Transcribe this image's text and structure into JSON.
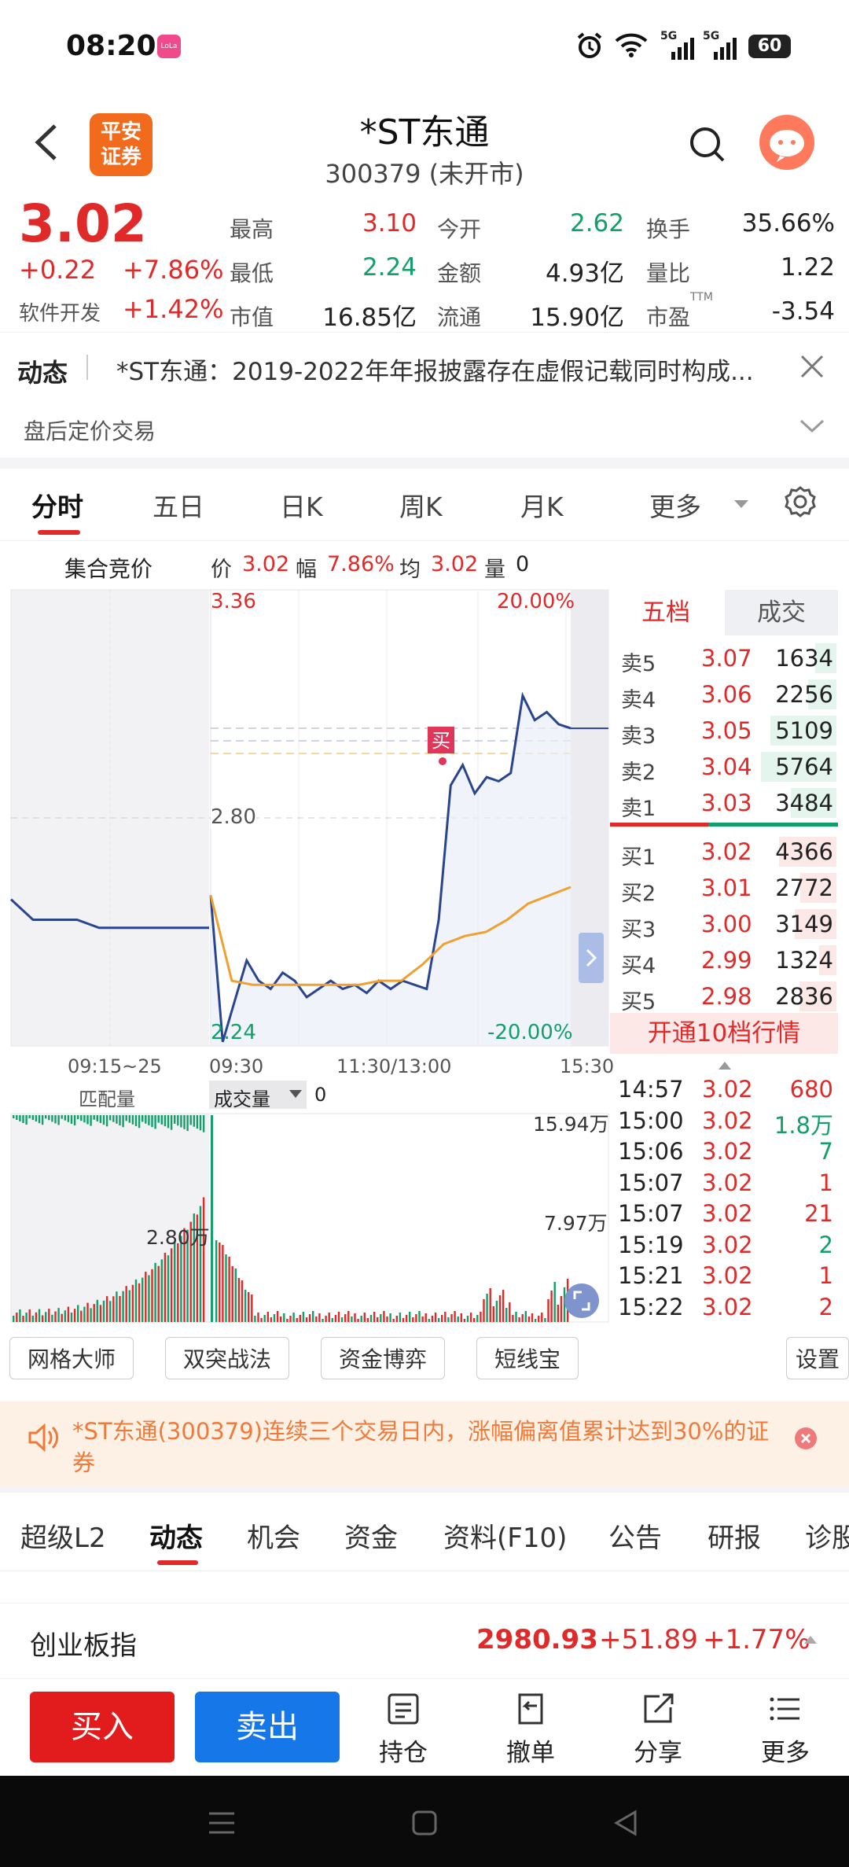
{
  "status_bar": {
    "time": "08:20",
    "app_badge": "LoLa",
    "net1": "5G",
    "net2": "5G",
    "battery": "60"
  },
  "header": {
    "title": "*ST东通",
    "subtitle": "300379 (未开市)",
    "logo_line1": "平安",
    "logo_line2": "证券"
  },
  "quote": {
    "price": "3.02",
    "change": "+0.22",
    "change_pct": "+7.86%",
    "sector": "软件开发",
    "sector_pct": "+1.42%",
    "stats": [
      {
        "label": "最高",
        "value": "3.10",
        "color": "red"
      },
      {
        "label": "今开",
        "value": "2.62",
        "color": "green"
      },
      {
        "label": "换手",
        "value": "35.66%",
        "color": "black"
      },
      {
        "label": "最低",
        "value": "2.24",
        "color": "green"
      },
      {
        "label": "金额",
        "value": "4.93亿",
        "color": "black"
      },
      {
        "label": "量比",
        "value": "1.22",
        "color": "black"
      },
      {
        "label": "市值",
        "value": "16.85亿",
        "color": "black"
      },
      {
        "label": "流通",
        "value": "15.90亿",
        "color": "black"
      },
      {
        "label": "市盈",
        "label_sup": "TTM",
        "value": "-3.54",
        "color": "black"
      }
    ]
  },
  "news": {
    "tag": "动态",
    "text": "*ST东通：2019-2022年年报披露存在虚假记载同时构成...",
    "after_hours": "盘后定价交易"
  },
  "chart_tabs": [
    "分时",
    "五日",
    "日K",
    "周K",
    "月K",
    "更多"
  ],
  "info_line": {
    "title": "集合竞价",
    "price_label": "价",
    "price": "3.02",
    "amp_label": "幅",
    "amp": "7.86%",
    "avg_label": "均",
    "avg": "3.02",
    "vol_label": "量",
    "vol": "0"
  },
  "chart_data": {
    "type": "line",
    "y_top_label": "3.36",
    "y_mid_label": "2.80",
    "y_bottom_label": "2.24",
    "pct_top": "20.00%",
    "pct_bottom": "-20.00%",
    "x_labels": [
      "09:15~25",
      "09:30",
      "11:30/13:00",
      "15:30"
    ],
    "ylim": [
      2.24,
      3.36
    ],
    "series": [
      {
        "values": [
          2.6,
          2.55,
          2.55,
          2.55,
          2.53,
          2.53,
          2.53,
          2.53,
          2.53,
          2.53,
          2.61,
          2.25,
          2.35,
          2.45,
          2.4,
          2.38,
          2.42,
          2.4,
          2.36,
          2.38,
          2.4,
          2.38,
          2.39,
          2.37,
          2.4,
          2.38,
          2.4,
          2.39,
          2.38,
          2.55,
          2.88,
          2.93,
          2.86,
          2.9,
          2.89,
          2.91,
          3.1,
          3.04,
          3.06,
          3.03,
          3.02
        ]
      },
      {
        "values": [
          2.61,
          2.4,
          2.39,
          2.39,
          2.39,
          2.39,
          2.39,
          2.39,
          2.4,
          2.4,
          2.44,
          2.49,
          2.51,
          2.52,
          2.55,
          2.59,
          2.61,
          2.63
        ]
      }
    ],
    "volume_labels": {
      "left_top": "匹配量",
      "selector": "成交量",
      "value": "0",
      "max": "15.94万",
      "mid": "7.97万",
      "auction": "2.80万"
    }
  },
  "order_book": {
    "tabs": [
      "五档",
      "成交"
    ],
    "asks": [
      {
        "name": "卖5",
        "price": "3.07",
        "vol": "1634",
        "frac": 0.28
      },
      {
        "name": "卖4",
        "price": "3.06",
        "vol": "2256",
        "frac": 0.38
      },
      {
        "name": "卖3",
        "price": "3.05",
        "vol": "5109",
        "frac": 0.88
      },
      {
        "name": "卖2",
        "price": "3.04",
        "vol": "5764",
        "frac": 1.0
      },
      {
        "name": "卖1",
        "price": "3.03",
        "vol": "3484",
        "frac": 0.6
      }
    ],
    "bids": [
      {
        "name": "买1",
        "price": "3.02",
        "vol": "4366",
        "frac": 0.76
      },
      {
        "name": "买2",
        "price": "3.01",
        "vol": "2772",
        "frac": 0.48
      },
      {
        "name": "买3",
        "price": "3.00",
        "vol": "3149",
        "frac": 0.55
      },
      {
        "name": "买4",
        "price": "2.99",
        "vol": "1324",
        "frac": 0.23
      },
      {
        "name": "买5",
        "price": "2.98",
        "vol": "2836",
        "frac": 0.49
      }
    ],
    "promo": "开通10档行情",
    "ticks": [
      {
        "time": "14:57",
        "price": "3.02",
        "vol": "680",
        "color": "red"
      },
      {
        "time": "15:00",
        "price": "3.02",
        "vol": "1.8万",
        "color": "green"
      },
      {
        "time": "15:06",
        "price": "3.02",
        "vol": "7",
        "color": "green"
      },
      {
        "time": "15:07",
        "price": "3.02",
        "vol": "1",
        "color": "red"
      },
      {
        "time": "15:07",
        "price": "3.02",
        "vol": "21",
        "color": "red"
      },
      {
        "time": "15:19",
        "price": "3.02",
        "vol": "2",
        "color": "green"
      },
      {
        "time": "15:21",
        "price": "3.02",
        "vol": "1",
        "color": "red"
      },
      {
        "time": "15:22",
        "price": "3.02",
        "vol": "2",
        "color": "red"
      }
    ]
  },
  "tools": [
    "网格大师",
    "双突战法",
    "资金博弈",
    "短线宝",
    "设置"
  ],
  "notice": {
    "text": "*ST东通(300379)连续三个交易日内，涨幅偏离值累计达到30%的证券"
  },
  "bottom_tabs": [
    "超级L2",
    "动态",
    "机会",
    "资金",
    "资料(F10)",
    "公告",
    "研报",
    "诊股"
  ],
  "index": {
    "name": "创业板指",
    "value": "2980.93",
    "change": "+51.89",
    "pct": "+1.77%"
  },
  "actions": {
    "buy": "买入",
    "sell": "卖出",
    "items": [
      "持仓",
      "撤单",
      "分享",
      "更多"
    ]
  },
  "colors": {
    "up": "#e02a2a",
    "down": "#12a06a",
    "price_line": "#2a4590",
    "avg_line": "#f0a030",
    "buy_btn": "#e21c1c",
    "sell_btn": "#1677e8"
  }
}
